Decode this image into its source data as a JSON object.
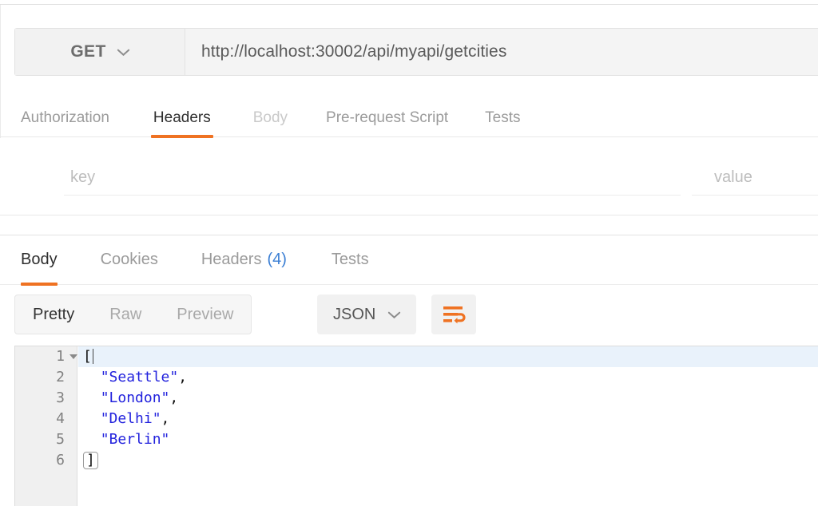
{
  "request": {
    "method": "GET",
    "method_icon": "chevron-down-icon",
    "url": "http://localhost:30002/api/myapi/getcities",
    "tabs": [
      {
        "label": "Authorization",
        "state": "normal"
      },
      {
        "label": "Headers",
        "state": "active"
      },
      {
        "label": "Body",
        "state": "dim"
      },
      {
        "label": "Pre-request Script",
        "state": "normal"
      },
      {
        "label": "Tests",
        "state": "normal"
      }
    ],
    "headers_table": {
      "key_placeholder": "key",
      "key_value": "",
      "value_placeholder": "value",
      "value_value": ""
    }
  },
  "response": {
    "tabs": [
      {
        "label": "Body",
        "state": "active",
        "count": ""
      },
      {
        "label": "Cookies",
        "state": "normal",
        "count": ""
      },
      {
        "label": "Headers",
        "state": "normal",
        "count": "(4)"
      },
      {
        "label": "Tests",
        "state": "normal",
        "count": ""
      }
    ],
    "view_modes": [
      {
        "label": "Pretty",
        "state": "active"
      },
      {
        "label": "Raw",
        "state": "normal"
      },
      {
        "label": "Preview",
        "state": "normal"
      }
    ],
    "format": {
      "selected": "JSON",
      "icon": "chevron-down-icon"
    },
    "wrap_button_icon": "word-wrap-icon",
    "body": {
      "language": "json",
      "lines": [
        {
          "number": "1",
          "open": "[",
          "text": "",
          "foldable": true,
          "active": true
        },
        {
          "number": "2",
          "string": "\"Seattle\"",
          "comma": ",",
          "active": false
        },
        {
          "number": "3",
          "string": "\"London\"",
          "comma": ",",
          "active": false
        },
        {
          "number": "4",
          "string": "\"Delhi\"",
          "comma": ",",
          "active": false
        },
        {
          "number": "5",
          "string": "\"Berlin\"",
          "comma": "",
          "active": false
        },
        {
          "number": "6",
          "close": "]",
          "active": false
        }
      ],
      "values": [
        "Seattle",
        "London",
        "Delhi",
        "Berlin"
      ]
    }
  },
  "colors": {
    "accent": "#ef7222",
    "string": "#2222dd",
    "link": "#3b7fd4",
    "panel": "#f2f2f2",
    "border": "#e2e2e2"
  }
}
